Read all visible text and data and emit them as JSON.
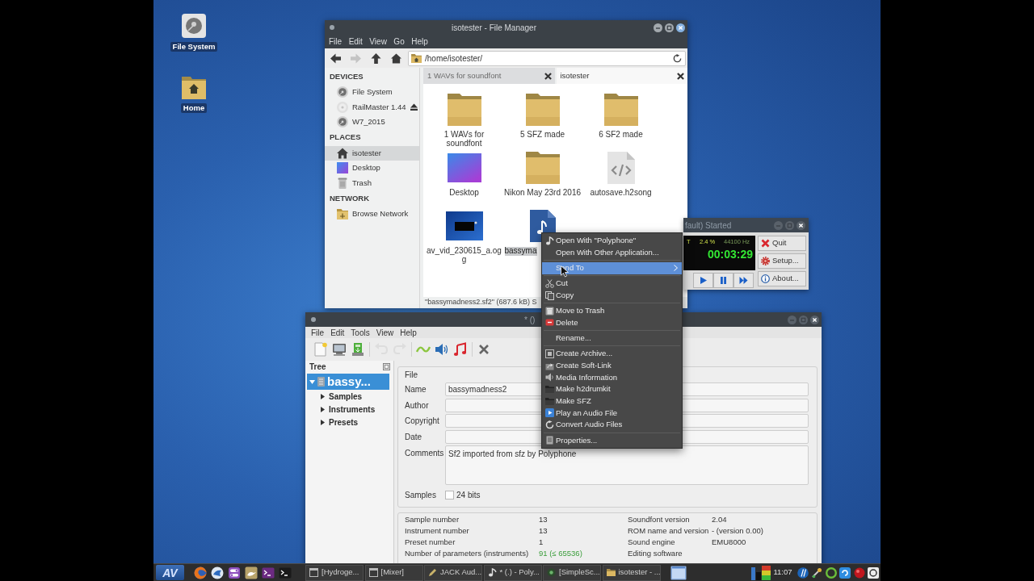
{
  "desktop": {
    "icons": [
      {
        "label": "File System",
        "kind": "drive"
      },
      {
        "label": "Home",
        "kind": "home"
      }
    ]
  },
  "file_manager": {
    "title": "isotester - File Manager",
    "menu": [
      "File",
      "Edit",
      "View",
      "Go",
      "Help"
    ],
    "nav": [
      {
        "kind": "back",
        "disabled": false
      },
      {
        "kind": "forward",
        "disabled": true
      },
      {
        "kind": "up",
        "disabled": false
      },
      {
        "kind": "home",
        "disabled": false
      }
    ],
    "path": "/home/isotester/",
    "sidebar": [
      {
        "heading": "DEVICES",
        "items": [
          {
            "label": "File System",
            "kind": "drive",
            "selected": false,
            "eject": false
          },
          {
            "label": "RailMaster 1.44",
            "kind": "disc",
            "selected": false,
            "eject": true
          },
          {
            "label": "W7_2015",
            "kind": "drive",
            "selected": false,
            "eject": false
          }
        ]
      },
      {
        "heading": "PLACES",
        "items": [
          {
            "label": "isotester",
            "kind": "home",
            "selected": true,
            "eject": false
          },
          {
            "label": "Desktop",
            "kind": "desktop",
            "selected": false,
            "eject": false
          },
          {
            "label": "Trash",
            "kind": "trash",
            "selected": false,
            "eject": false
          }
        ]
      },
      {
        "heading": "NETWORK",
        "items": [
          {
            "label": "Browse Network",
            "kind": "network",
            "selected": false,
            "eject": false
          }
        ]
      }
    ],
    "tabs": [
      {
        "label": "1 WAVs for soundfont",
        "selected": false
      },
      {
        "label": "isotester",
        "selected": true
      }
    ],
    "files": [
      {
        "name": "1 WAVs for soundfont",
        "kind": "folder",
        "selected": false
      },
      {
        "name": "5 SFZ made",
        "kind": "folder",
        "selected": false
      },
      {
        "name": "6 SF2 made",
        "kind": "folder",
        "selected": false
      },
      {
        "name": "Desktop",
        "kind": "image",
        "selected": false
      },
      {
        "name": "Nikon May 23rd 2016",
        "kind": "folder",
        "selected": false
      },
      {
        "name": "autosave.h2song",
        "kind": "code",
        "selected": false
      },
      {
        "name": "av_vid_230615_a.ogg",
        "kind": "video",
        "selected": false
      },
      {
        "name": "bassyma",
        "kind": "audio",
        "selected": true
      }
    ],
    "status": "\"bassymadness2.sf2\" (687.6 kB) S"
  },
  "jack": {
    "title": "fault) Started",
    "display": {
      "left_text": "T",
      "cpu": "2.4 %",
      "rate": "44100 Hz",
      "time": "00:03:29"
    },
    "transport": [
      {
        "kind": "play"
      },
      {
        "kind": "pause"
      },
      {
        "kind": "forward"
      }
    ],
    "buttons": [
      {
        "label": "Quit",
        "kind": "quit"
      },
      {
        "label": "Setup...",
        "kind": "setup"
      },
      {
        "label": "About...",
        "kind": "about"
      }
    ]
  },
  "polyphone": {
    "title": "* ()",
    "menu": [
      "File",
      "Edit",
      "Tools",
      "View",
      "Help"
    ],
    "toolbar": [
      {
        "kind": "new",
        "disabled": false
      },
      {
        "kind": "open",
        "disabled": false
      },
      {
        "kind": "save",
        "disabled": false
      },
      {
        "kind": "separator"
      },
      {
        "kind": "undo",
        "disabled": true
      },
      {
        "kind": "redo",
        "disabled": true
      },
      {
        "kind": "separator"
      },
      {
        "kind": "wave",
        "disabled": false
      },
      {
        "kind": "speaker",
        "disabled": false
      },
      {
        "kind": "note",
        "disabled": false
      },
      {
        "kind": "separator"
      },
      {
        "kind": "close",
        "disabled": false
      }
    ],
    "tree": {
      "title": "Tree",
      "items": [
        {
          "label": "bassy...",
          "selected": true,
          "expanded": true,
          "children": [
            {
              "label": "Samples",
              "selected": false,
              "expanded": false
            },
            {
              "label": "Instruments",
              "selected": false,
              "expanded": false
            },
            {
              "label": "Presets",
              "selected": false,
              "expanded": false
            }
          ]
        }
      ]
    },
    "file_group": {
      "title": "File",
      "fields": [
        {
          "label": "Name",
          "kind": "line",
          "value": "bassymadness2"
        },
        {
          "label": "Author",
          "kind": "line"
        },
        {
          "label": "Copyright",
          "kind": "line"
        },
        {
          "label": "Date",
          "kind": "line"
        },
        {
          "label": "Comments",
          "kind": "multiline",
          "value": "Sf2 imported from sfz by Polyphone"
        }
      ],
      "samples": {
        "label": "Samples",
        "option": "24 bits",
        "checked": false
      }
    },
    "info": {
      "left": [
        {
          "label": "Sample number",
          "value": "13",
          "highlighted": false
        },
        {
          "label": "Instrument number",
          "value": "13",
          "highlighted": false
        },
        {
          "label": "Preset number",
          "value": "1",
          "highlighted": false
        },
        {
          "label": "Number of parameters (instruments)",
          "value": "91 (≤ 65536)",
          "highlighted": true
        }
      ],
      "right": [
        {
          "label": "Soundfont version",
          "value": "2.04"
        },
        {
          "label": "ROM name and version",
          "value": "- (version 0.00)"
        },
        {
          "label": "Sound engine",
          "value": "EMU8000"
        },
        {
          "label": "Editing software"
        }
      ]
    }
  },
  "context_menu": {
    "items": [
      {
        "kind": "open_with",
        "label": "Open With \"Polyphone\"",
        "selected": false
      },
      {
        "kind": "open_other",
        "label": "Open With Other Application...",
        "selected": false
      },
      {
        "kind": "separator"
      },
      {
        "kind": "submenu",
        "label": "Send To",
        "selected": true
      },
      {
        "kind": "separator"
      },
      {
        "kind": "cut",
        "label": "Cut",
        "selected": false
      },
      {
        "kind": "copy",
        "label": "Copy",
        "selected": false
      },
      {
        "kind": "separator"
      },
      {
        "kind": "trash",
        "label": "Move to Trash",
        "selected": false
      },
      {
        "kind": "delete",
        "label": "Delete",
        "selected": false
      },
      {
        "kind": "separator"
      },
      {
        "kind": "rename",
        "label": "Rename...",
        "selected": false
      },
      {
        "kind": "separator"
      },
      {
        "kind": "archive",
        "label": "Create Archive...",
        "selected": false
      },
      {
        "kind": "link",
        "label": "Create Soft-Link",
        "selected": false
      },
      {
        "kind": "media",
        "label": "Media Information",
        "selected": false
      },
      {
        "kind": "drumkit",
        "label": "Make h2drumkit",
        "selected": false
      },
      {
        "kind": "sfz",
        "label": "Make SFZ",
        "selected": false
      },
      {
        "kind": "play",
        "label": "Play an Audio File",
        "selected": false
      },
      {
        "kind": "convert",
        "label": "Convert Audio Files",
        "selected": false
      },
      {
        "kind": "separator"
      },
      {
        "kind": "properties",
        "label": "Properties...",
        "selected": false
      }
    ]
  },
  "taskbar": {
    "start": "AV",
    "tasks": [
      {
        "label": "[Hydroge...",
        "kind": "window"
      },
      {
        "label": "[Mixer]",
        "kind": "window"
      },
      {
        "label": "JACK Aud...",
        "kind": "pen"
      },
      {
        "label": "* (.) - Poly...",
        "kind": "note"
      },
      {
        "label": "[SimpleSc...",
        "kind": "record"
      },
      {
        "label": "isotester - ...",
        "kind": "folder"
      }
    ],
    "clock": "11:07"
  }
}
